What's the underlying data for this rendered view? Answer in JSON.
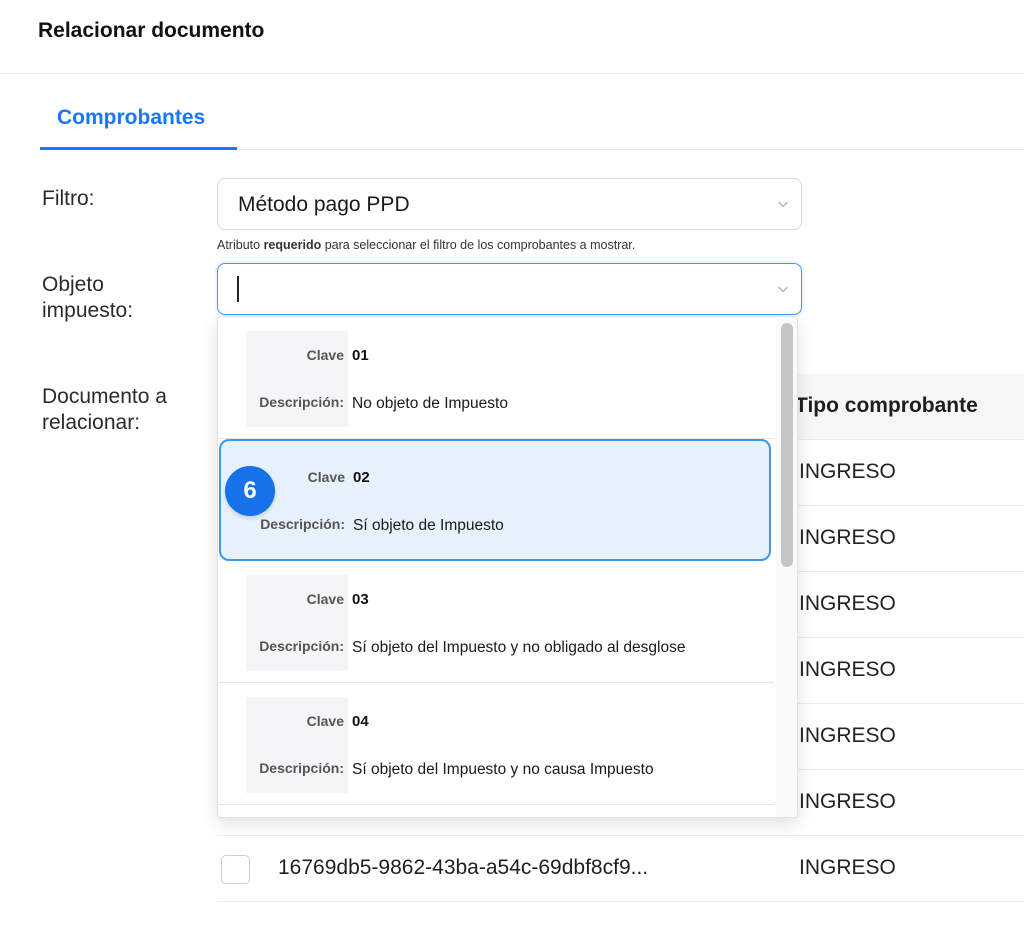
{
  "header": {
    "title": "Relacionar documento"
  },
  "tabs": [
    {
      "label": "Comprobantes",
      "active": true
    }
  ],
  "form": {
    "filtro": {
      "label": "Filtro:",
      "value": "Método pago PPD",
      "helper_prefix": "Atributo ",
      "helper_bold": "requerido",
      "helper_suffix": " para seleccionar el filtro de los comprobantes a mostrar."
    },
    "objeto_impuesto": {
      "label_line1": "Objeto",
      "label_line2": "impuesto:",
      "value": ""
    },
    "documento": {
      "label_line1": "Documento a",
      "label_line2": "relacionar:"
    }
  },
  "dropdown": {
    "key_clave": "Clave",
    "key_descripcion": "Descripción:",
    "options": [
      {
        "clave": "01",
        "descripcion": "No objeto de Impuesto"
      },
      {
        "clave": "02",
        "descripcion": "Sí objeto de Impuesto",
        "selected": true
      },
      {
        "clave": "03",
        "descripcion": "Sí objeto del Impuesto y no obligado al desglose"
      },
      {
        "clave": "04",
        "descripcion": "Sí objeto del Impuesto y no causa Impuesto"
      }
    ]
  },
  "table": {
    "header_tipo": "Tipo comprobante",
    "rows": [
      {
        "tipo": "INGRESO"
      },
      {
        "tipo": "INGRESO"
      },
      {
        "tipo": "INGRESO"
      },
      {
        "tipo": "INGRESO"
      },
      {
        "tipo": "INGRESO"
      },
      {
        "tipo": "INGRESO"
      },
      {
        "uuid": "16769db5-9862-43ba-a54c-69dbf8cf9...",
        "tipo": "INGRESO"
      }
    ]
  },
  "step_badge": "6",
  "colors": {
    "accent": "#1677ff",
    "selected_bg": "#e6f1fc",
    "selected_border": "#3f97ea",
    "badge": "#1572e8"
  },
  "icons": {
    "caret": "chevron-down-icon"
  }
}
